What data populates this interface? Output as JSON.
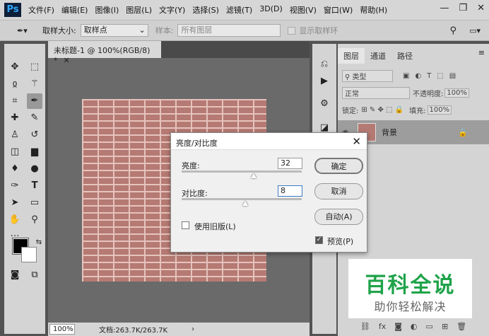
{
  "app": {
    "logo": "Ps"
  },
  "menu": [
    "文件(F)",
    "编辑(E)",
    "图像(I)",
    "图层(L)",
    "文字(Y)",
    "选择(S)",
    "滤镜(T)",
    "3D(D)",
    "视图(V)",
    "窗口(W)",
    "帮助(H)"
  ],
  "options": {
    "sample_size_label": "取样大小:",
    "sample_size_value": "取样点",
    "sample_label": "样本:",
    "sample_value": "所有图层",
    "show_ring": "显示取样环"
  },
  "document": {
    "tab_title": "未标题-1 @ 100%(RGB/8) *",
    "zoom": "100%",
    "doc_info": "文档:263.7K/263.7K"
  },
  "layers_panel": {
    "tabs": [
      "图层",
      "通道",
      "路径"
    ],
    "kind_label": "类型",
    "blend_mode": "正常",
    "opacity_label": "不透明度:",
    "opacity_value": "100%",
    "lock_label": "锁定:",
    "fill_label": "填充:",
    "fill_value": "100%",
    "layer_name": "背景"
  },
  "dialog": {
    "title": "亮度/对比度",
    "brightness_label": "亮度:",
    "brightness_value": "32",
    "brightness_level": 0.6,
    "contrast_label": "对比度:",
    "contrast_value": "8",
    "contrast_level": 0.53,
    "legacy_label": "使用旧版(L)",
    "legacy_checked": false,
    "preview_label": "预览(P)",
    "preview_checked": true,
    "ok": "确定",
    "cancel": "取消",
    "auto": "自动(A)"
  },
  "watermark": {
    "line1": "百科全说",
    "line2": "助你轻松解决"
  },
  "colors": {
    "brick": "#b57a73",
    "mortar": "#e6c3bd",
    "watermark_green": "#1fa34a"
  }
}
